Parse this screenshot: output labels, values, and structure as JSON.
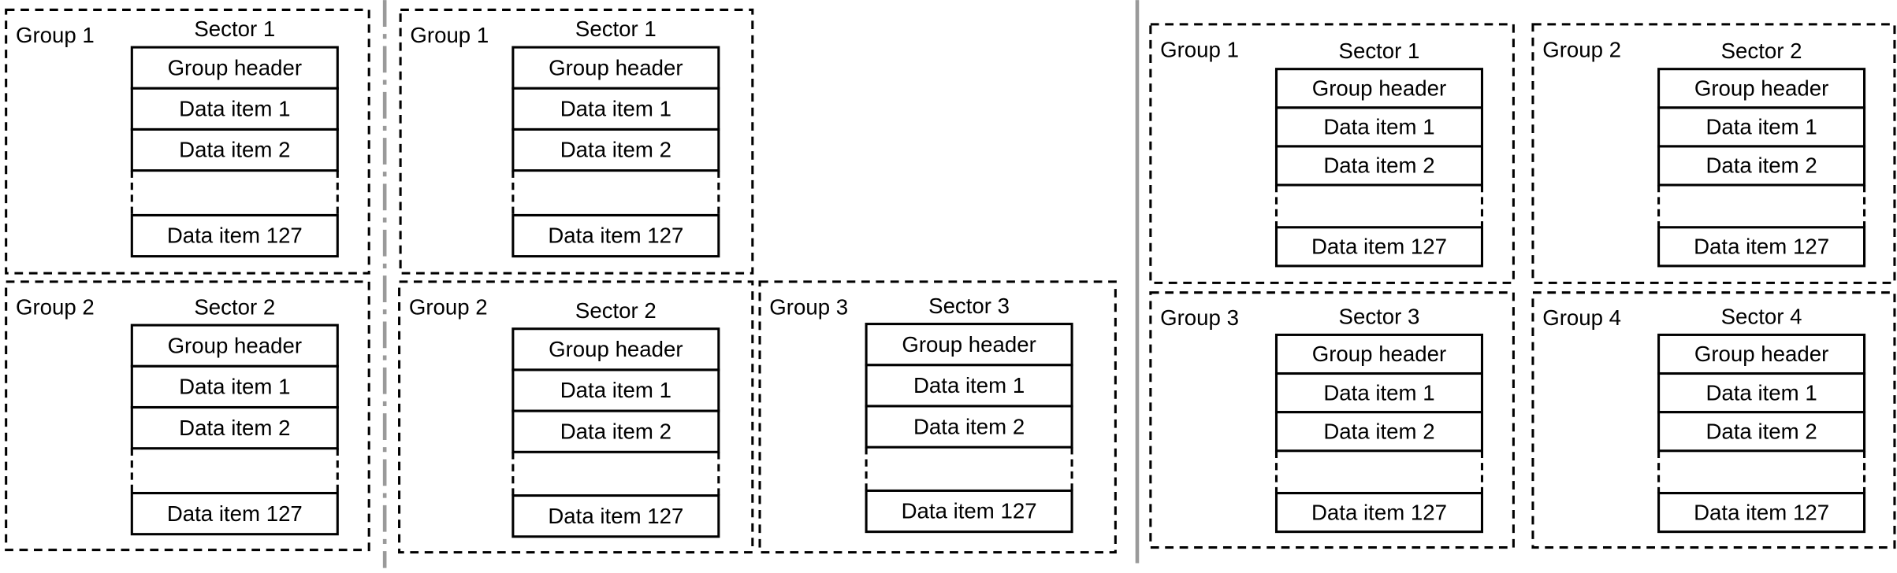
{
  "panels": [
    {
      "groups": [
        {
          "group": "Group 1",
          "sector": "Sector 1",
          "rows": [
            "Group header",
            "Data item 1",
            "Data item 2",
            "",
            "Data item 127"
          ]
        },
        {
          "group": "Group 2",
          "sector": "Sector 2",
          "rows": [
            "Group header",
            "Data item 1",
            "Data item 2",
            "",
            "Data item 127"
          ]
        }
      ]
    },
    {
      "groups": [
        {
          "group": "Group 1",
          "sector": "Sector 1",
          "rows": [
            "Group header",
            "Data item 1",
            "Data item 2",
            "",
            "Data item 127"
          ]
        },
        {
          "group": "Group 2",
          "sector": "Sector 2",
          "rows": [
            "Group header",
            "Data item 1",
            "Data item 2",
            "",
            "Data item 127"
          ]
        },
        {
          "group": "Group 3",
          "sector": "Sector 3",
          "rows": [
            "Group header",
            "Data item 1",
            "Data item 2",
            "",
            "Data item 127"
          ]
        }
      ]
    },
    {
      "groups": [
        {
          "group": "Group 1",
          "sector": "Sector 1",
          "rows": [
            "Group header",
            "Data item 1",
            "Data item 2",
            "",
            "Data item 127"
          ]
        },
        {
          "group": "Group 2",
          "sector": "Sector 2",
          "rows": [
            "Group header",
            "Data item 1",
            "Data item 2",
            "",
            "Data item 127"
          ]
        },
        {
          "group": "Group 3",
          "sector": "Sector 3",
          "rows": [
            "Group header",
            "Data item 1",
            "Data item 2",
            "",
            "Data item 127"
          ]
        },
        {
          "group": "Group 4",
          "sector": "Sector 4",
          "rows": [
            "Group header",
            "Data item 1",
            "Data item 2",
            "",
            "Data item 127"
          ]
        }
      ]
    }
  ],
  "colors": {
    "divider": "#9a9a9a",
    "line": "#000000"
  }
}
